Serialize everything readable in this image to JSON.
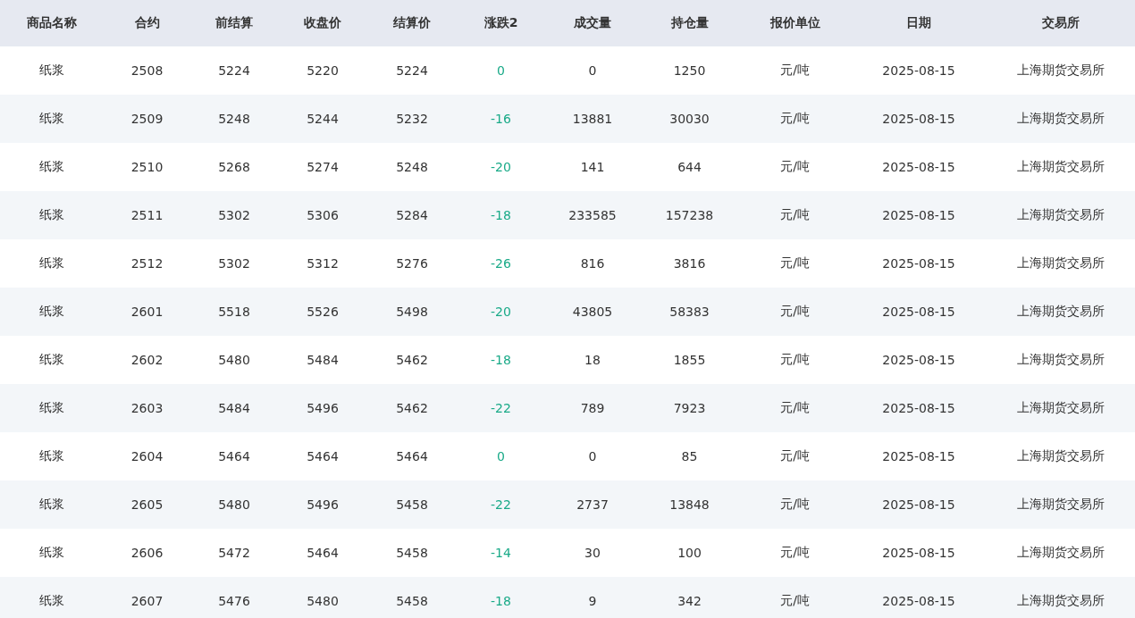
{
  "table": {
    "columns": [
      "商品名称",
      "合约",
      "前结算",
      "收盘价",
      "结算价",
      "涨跌2",
      "成交量",
      "持仓量",
      "报价单位",
      "日期",
      "交易所"
    ],
    "rows": [
      [
        "纸浆",
        "2508",
        "5224",
        "5220",
        "5224",
        "0",
        "0",
        "1250",
        "元/吨",
        "2025-08-15",
        "上海期货交易所"
      ],
      [
        "纸浆",
        "2509",
        "5248",
        "5244",
        "5232",
        "-16",
        "13881",
        "30030",
        "元/吨",
        "2025-08-15",
        "上海期货交易所"
      ],
      [
        "纸浆",
        "2510",
        "5268",
        "5274",
        "5248",
        "-20",
        "141",
        "644",
        "元/吨",
        "2025-08-15",
        "上海期货交易所"
      ],
      [
        "纸浆",
        "2511",
        "5302",
        "5306",
        "5284",
        "-18",
        "233585",
        "157238",
        "元/吨",
        "2025-08-15",
        "上海期货交易所"
      ],
      [
        "纸浆",
        "2512",
        "5302",
        "5312",
        "5276",
        "-26",
        "816",
        "3816",
        "元/吨",
        "2025-08-15",
        "上海期货交易所"
      ],
      [
        "纸浆",
        "2601",
        "5518",
        "5526",
        "5498",
        "-20",
        "43805",
        "58383",
        "元/吨",
        "2025-08-15",
        "上海期货交易所"
      ],
      [
        "纸浆",
        "2602",
        "5480",
        "5484",
        "5462",
        "-18",
        "18",
        "1855",
        "元/吨",
        "2025-08-15",
        "上海期货交易所"
      ],
      [
        "纸浆",
        "2603",
        "5484",
        "5496",
        "5462",
        "-22",
        "789",
        "7923",
        "元/吨",
        "2025-08-15",
        "上海期货交易所"
      ],
      [
        "纸浆",
        "2604",
        "5464",
        "5464",
        "5464",
        "0",
        "0",
        "85",
        "元/吨",
        "2025-08-15",
        "上海期货交易所"
      ],
      [
        "纸浆",
        "2605",
        "5480",
        "5496",
        "5458",
        "-22",
        "2737",
        "13848",
        "元/吨",
        "2025-08-15",
        "上海期货交易所"
      ],
      [
        "纸浆",
        "2606",
        "5472",
        "5464",
        "5458",
        "-14",
        "30",
        "100",
        "元/吨",
        "2025-08-15",
        "上海期货交易所"
      ],
      [
        "纸浆",
        "2607",
        "5476",
        "5480",
        "5458",
        "-18",
        "9",
        "342",
        "元/吨",
        "2025-08-15",
        "上海期货交易所"
      ]
    ]
  }
}
